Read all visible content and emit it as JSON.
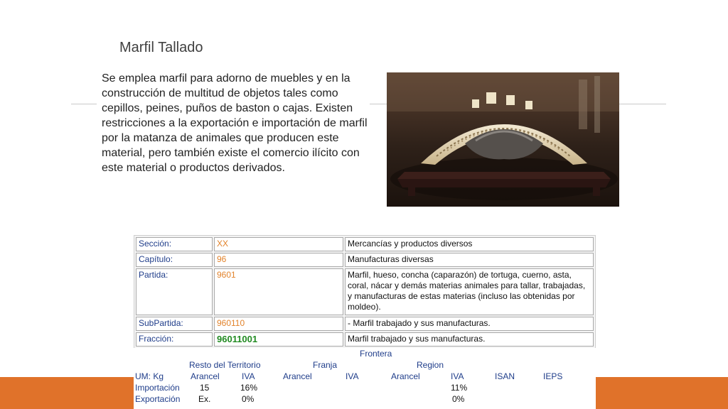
{
  "slide": {
    "title": "Marfil Tallado",
    "body": "Se emplea marfil para adorno de muebles y en la construcción de multitud de objetos tales como cepillos, peines, puños de baston o cajas. Existen restricciones a la exportación e importación de marfil por la matanza de animales que producen este material, pero también existe el comercio ilícito con este material o productos derivados.",
    "accent_color": "#e0722a"
  },
  "classification": {
    "rows": [
      {
        "label": "Sección:",
        "code": "XX",
        "desc": "Mercancías y productos diversos"
      },
      {
        "label": "Capítulo:",
        "code": "96",
        "desc": "Manufacturas diversas"
      },
      {
        "label": "Partida:",
        "code": "9601",
        "desc": "Marfil, hueso, concha (caparazón) de tortuga, cuerno, asta, coral, nácar y demás materias animales para tallar, trabajadas, y manufacturas de estas materias (incluso las obtenidas por moldeo)."
      },
      {
        "label": "SubPartida:",
        "code": "960110",
        "desc": "- Marfil trabajado y sus manufacturas."
      },
      {
        "label": "Fracción:",
        "code": "96011001",
        "desc": "Marfil trabajado y sus manufacturas."
      }
    ]
  },
  "tariff": {
    "frontera": "Frontera",
    "resto": "Resto del Territorio",
    "franja": "Franja",
    "region": "Region",
    "um": "UM: Kg",
    "col_arancel": "Arancel",
    "col_iva": "IVA",
    "col_isan": "ISAN",
    "col_ieps": "IEPS",
    "importacion": {
      "label": "Importación",
      "arancel": "15",
      "iva": "16%",
      "region_iva": "11%"
    },
    "exportacion": {
      "label": "Exportación",
      "arancel": "Ex.",
      "iva": "0%",
      "region_iva": "0%"
    }
  }
}
